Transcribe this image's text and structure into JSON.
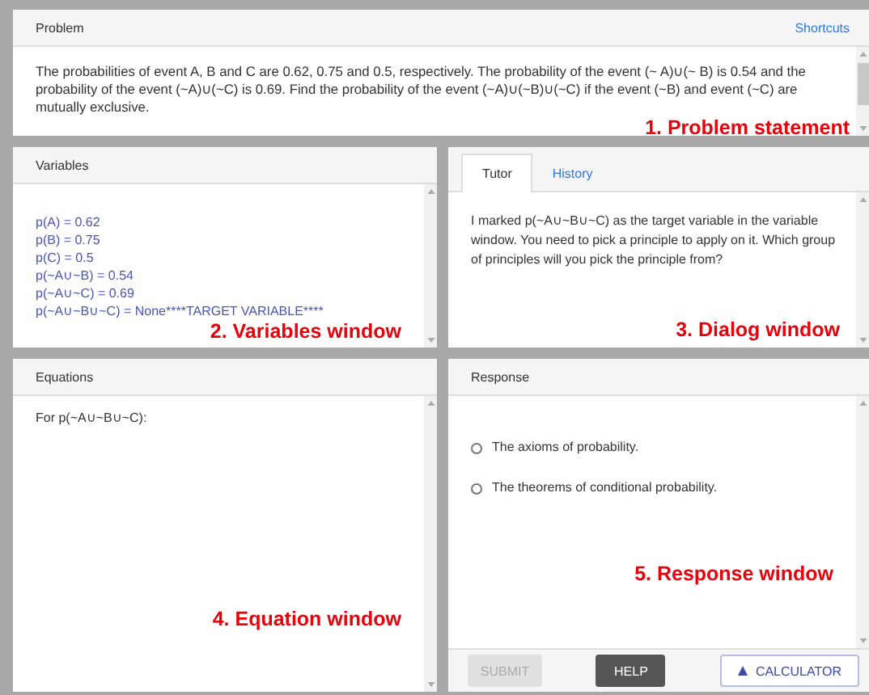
{
  "problem": {
    "title": "Problem",
    "shortcuts": "Shortcuts",
    "text": "The probabilities of event A, B and C are 0.62, 0.75 and 0.5, respectively. The probability of the event (~ A)∪(~ B) is 0.54 and the probability of the event (~A)∪(~C) is 0.69. Find the probability of the event (~A)∪(~B)∪(~C) if the event (~B) and event (~C) are mutually exclusive.",
    "annotation": "1. Problem statement"
  },
  "variables": {
    "title": "Variables",
    "lines": [
      "p(A) = 0.62",
      "p(B) = 0.75",
      "p(C) = 0.5",
      "p(~A∪~B) = 0.54",
      "p(~A∪~C) = 0.69",
      "p(~A∪~B∪~C) = None****TARGET VARIABLE****"
    ],
    "annotation": "2. Variables window"
  },
  "dialog": {
    "tabs": [
      {
        "label": "Tutor",
        "selected": true
      },
      {
        "label": "History",
        "selected": false
      }
    ],
    "message": "I marked p(~A∪~B∪~C) as the target variable in the variable window. You need to pick a principle to apply on it. Which group of principles will you pick the principle from?",
    "annotation": "3. Dialog window"
  },
  "equations": {
    "title": "Equations",
    "lines": [
      "For p(~A∪~B∪~C):"
    ],
    "annotation": "4. Equation window"
  },
  "response": {
    "title": "Response",
    "options": [
      {
        "label": "The axioms of probability.",
        "selected": false
      },
      {
        "label": "The theorems of conditional probability.",
        "selected": false
      }
    ],
    "annotation": "5. Response window",
    "buttons": [
      {
        "label": "SUBMIT",
        "kind": "disabled"
      },
      {
        "label": "HELP",
        "kind": "dark"
      },
      {
        "label": "CALCULATOR",
        "kind": "outline"
      }
    ]
  }
}
